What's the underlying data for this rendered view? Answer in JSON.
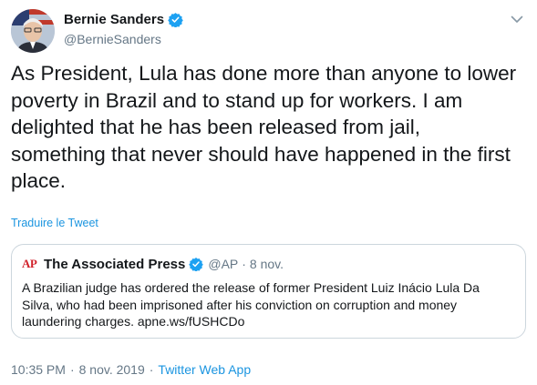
{
  "author": {
    "name": "Bernie Sanders",
    "handle": "@BernieSanders"
  },
  "tweet": {
    "lines": [
      "As President, Lula has done more than anyone to lower",
      "poverty in Brazil and to stand up for workers. I am",
      "delighted that he has been released from jail,",
      "something that never should have happened in the first",
      "place."
    ],
    "translate_label": "Traduire le Tweet"
  },
  "quote": {
    "logo_text": "AP",
    "name": "The Associated Press",
    "handle": "@AP",
    "separator": "·",
    "date": "8 nov.",
    "lines": [
      "A Brazilian judge has ordered the release of former President Luiz Inácio Lula Da",
      "Silva, who had been imprisoned after his conviction on corruption and money",
      "laundering charges. apne.ws/fUSHCDo"
    ]
  },
  "meta": {
    "time": "10:35 PM",
    "sep1": "·",
    "date": "8 nov. 2019",
    "sep2": "·",
    "app": "Twitter Web App"
  },
  "colors": {
    "link": "#1b95e0",
    "verified": "#1da1f2",
    "muted": "#657786",
    "ap_red": "#d1222b"
  },
  "icons": {
    "verified": "verified-badge-icon",
    "caret": "chevron-down-icon"
  }
}
